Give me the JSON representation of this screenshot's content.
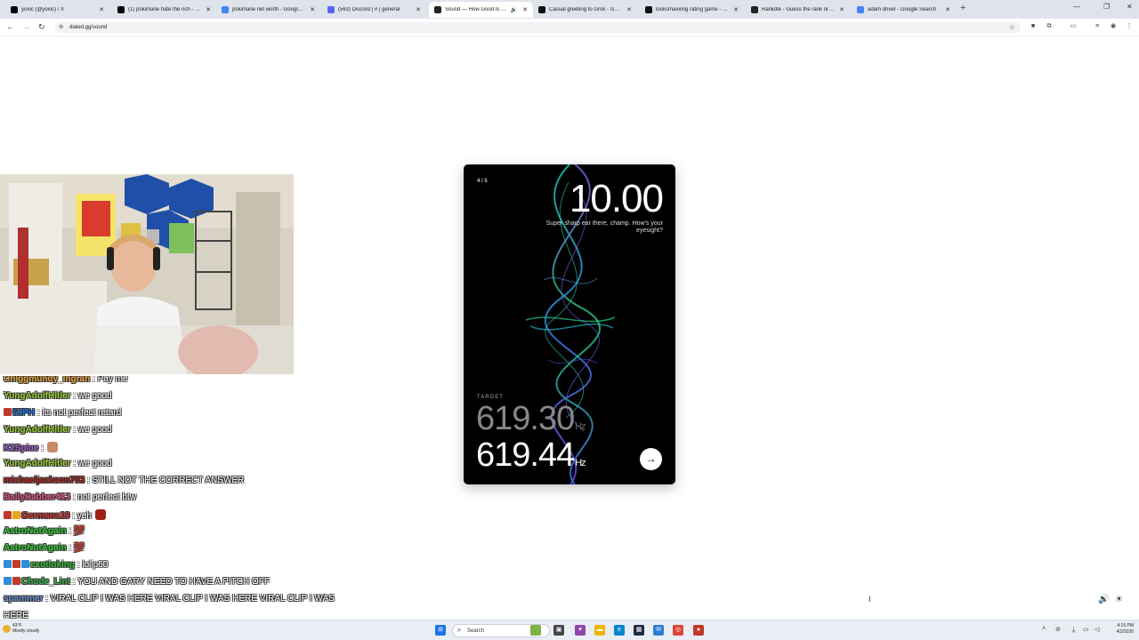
{
  "browser": {
    "tabs": [
      {
        "title": "yoxic (@yoxic) / X",
        "icon": "x-logo",
        "color": "#000000"
      },
      {
        "title": "(1) pokimane hate the rich - Se",
        "icon": "x-logo",
        "color": "#000000"
      },
      {
        "title": "pokimane net worth - Google S",
        "icon": "google-g",
        "color": "#4285f4"
      },
      {
        "title": "(563) Discord | # | general",
        "icon": "discord-logo",
        "color": "#5865f2"
      },
      {
        "title": "Sound — How Good Is You",
        "icon": "dialed-logo",
        "color": "#222222",
        "active": true
      },
      {
        "title": "Casual greeting to Grok - Grok",
        "icon": "grok-logo",
        "color": "#111111"
      },
      {
        "title": "looksmaxxing rating game - Gr",
        "icon": "grok-logo",
        "color": "#111111"
      },
      {
        "title": "Rankdle - Guess the rank or gu",
        "icon": "rankdle-logo",
        "color": "#222222"
      },
      {
        "title": "adam driver - Google Search",
        "icon": "google-g",
        "color": "#4285f4"
      }
    ],
    "url": "dialed.gg/sound"
  },
  "game": {
    "step": "4 / 5",
    "score": "10.00",
    "message": "Super sharp ear there, champ. How's your eyesight?",
    "target_label": "TARGET",
    "target_value": "619.30",
    "guess_value": "619.44",
    "unit": "Hz"
  },
  "chat": [
    {
      "user": "Chiggmundy_Ingrah",
      "msg": ": Pay me",
      "color": "#e8a33a"
    },
    {
      "user": "YungAdolfHitler",
      "msg": ": we good",
      "color": "#9acd32"
    },
    {
      "user": "53PH",
      "msg": ": its not perfect retard",
      "color": "#1e6fd9",
      "badges": [
        "#c0392b"
      ]
    },
    {
      "user": "YungAdolfHitler",
      "msg": ": we good",
      "color": "#9acd32"
    },
    {
      "user": "K2Spice",
      "msg": ":",
      "color": "#a35bd6",
      "emote": "#c98a6a"
    },
    {
      "user": "YungAdolfHitler",
      "msg": ": we good",
      "color": "#9acd32"
    },
    {
      "user": "michaeljackson753",
      "msg": ": STILL NOT THE CORRECT ANSWER",
      "color": "#b22222"
    },
    {
      "user": "DailyDabber413",
      "msg": ": not perfect btw",
      "color": "#e0567a"
    },
    {
      "user": "Germans19",
      "msg": ": yeh",
      "color": "#d2302a",
      "badges": [
        "#c0392b",
        "#e6a817"
      ],
      "emote": "#a0201a"
    },
    {
      "user": "AstroNotAgain",
      "msg": ": 💯",
      "color": "#32cd32"
    },
    {
      "user": "AstroNotAgain",
      "msg": ": 💯",
      "color": "#32cd32"
    },
    {
      "user": "exotioking",
      "msg": ": lolip60",
      "color": "#2fbf2f",
      "badges": [
        "#2f8fd6",
        "#c0392b",
        "#2f8fd6"
      ]
    },
    {
      "user": "Chode_Lint",
      "msg": ": YOU AND GARY NEED TO HAVE A PITCH OFF",
      "color": "#3ab54a",
      "badges": [
        "#2f8fd6",
        "#c0392b"
      ]
    },
    {
      "user": "spammer",
      "msg": ": VIRAL CLIP I WAS HERE VIRAL CLIP I WAS HERE VIRAL CLIP I WAS",
      "color": "#6a8fd6"
    },
    {
      "user": "",
      "msg": "HERE",
      "color": "#ffffff"
    }
  ],
  "taskbar": {
    "weather_temp": "43°F",
    "weather_desc": "Mostly cloudy",
    "search_placeholder": "Search",
    "time": "4:15 PM",
    "date": "4/2/2026"
  }
}
